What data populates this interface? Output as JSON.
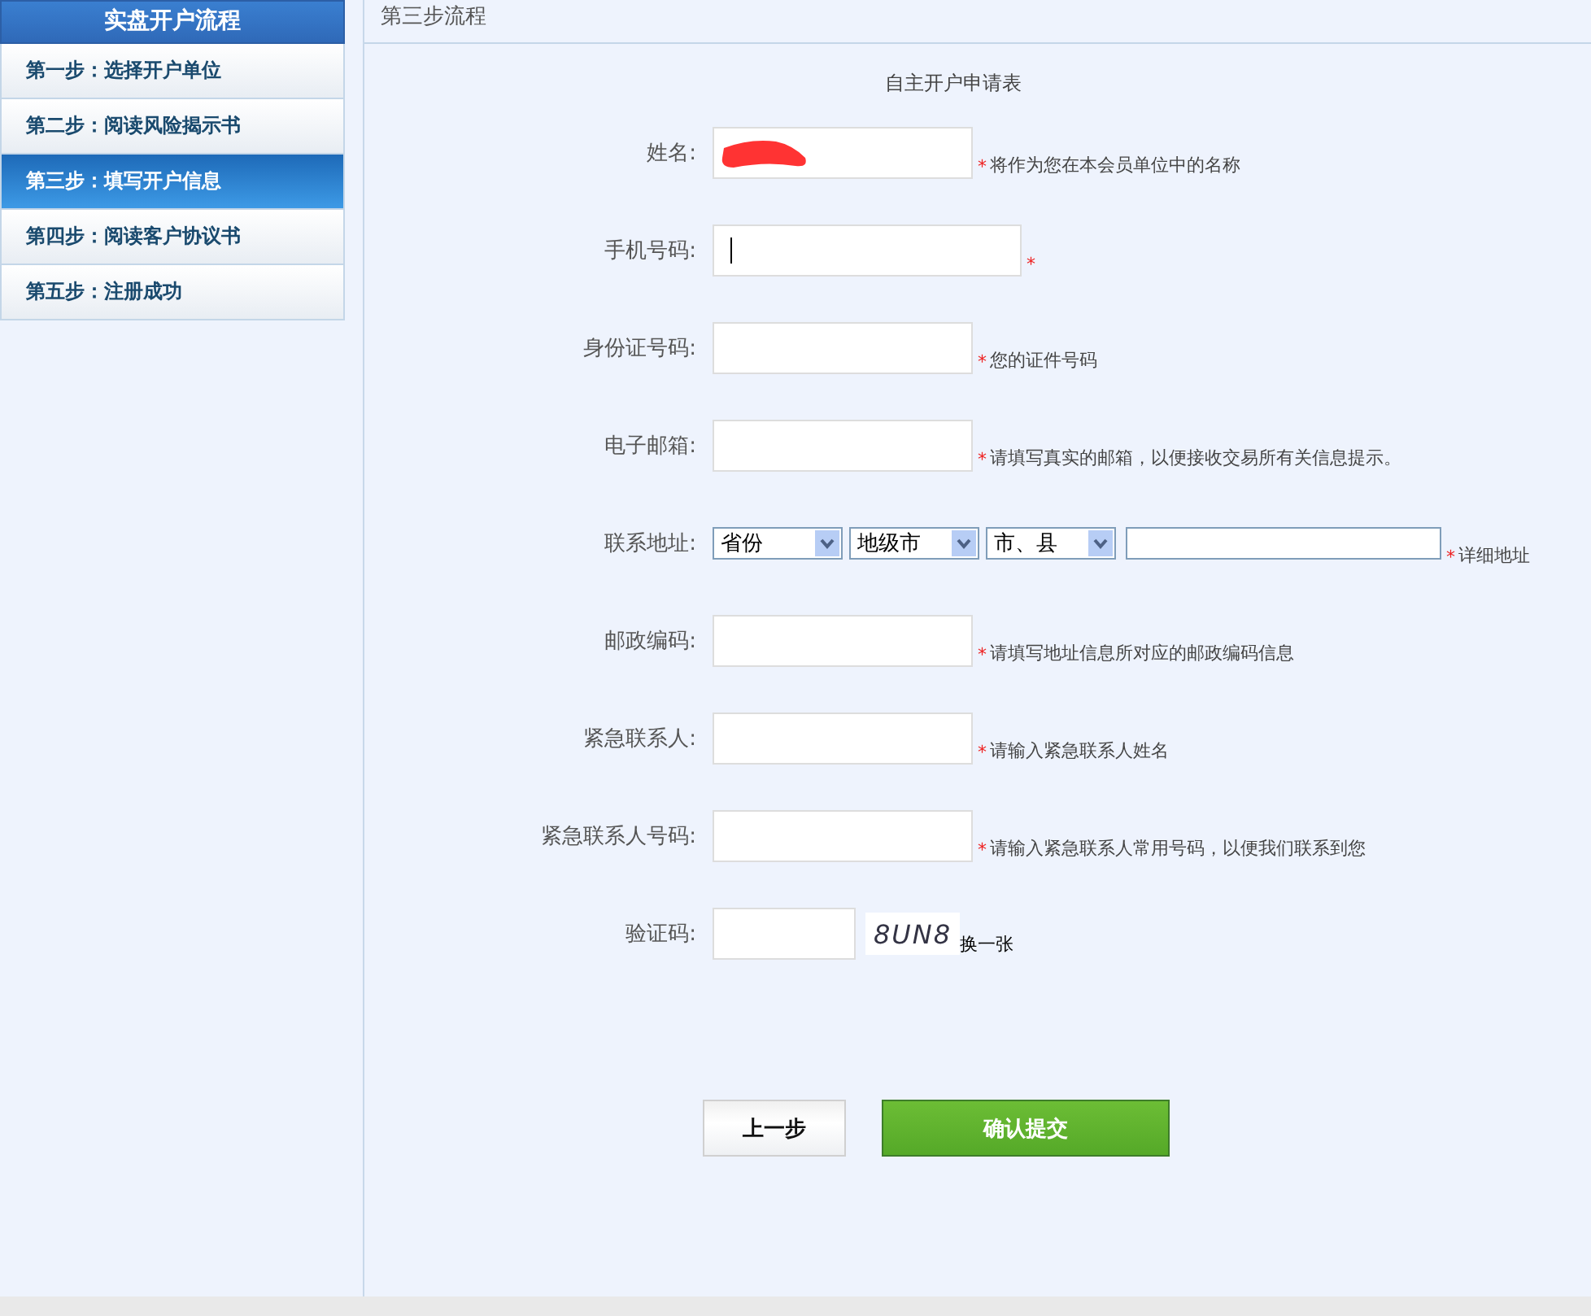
{
  "sidebar": {
    "title": "实盘开户流程",
    "items": [
      {
        "label": "第一步：选择开户单位",
        "selected": false
      },
      {
        "label": "第二步：阅读风险揭示书",
        "selected": false
      },
      {
        "label": "第三步：填写开户信息",
        "selected": true
      },
      {
        "label": "第四步：阅读客户协议书",
        "selected": false
      },
      {
        "label": "第五步：注册成功",
        "selected": false
      }
    ]
  },
  "main": {
    "header": "第三步流程",
    "form_title": "自主开户申请表",
    "fields": [
      {
        "kind": "text",
        "label": "姓名:",
        "redacted": true,
        "mark": "*",
        "hint": "将作为您在本会员单位中的名称"
      },
      {
        "kind": "text",
        "label": "手机号码:",
        "focused": true,
        "wide": true,
        "mark": "*"
      },
      {
        "kind": "text",
        "label": "身份证号码:",
        "mark": "*",
        "hint": "您的证件号码"
      },
      {
        "kind": "text",
        "label": "电子邮箱:",
        "mark": "*",
        "hint": "请填写真实的邮箱，以便接收交易所有关信息提示。"
      },
      {
        "kind": "address",
        "label": "联系地址:",
        "selects": [
          "省份",
          "地级市",
          "市、县"
        ],
        "mark": "*",
        "hint": "详细地址"
      },
      {
        "kind": "text",
        "label": "邮政编码:",
        "mark": "*",
        "hint": "请填写地址信息所对应的邮政编码信息"
      },
      {
        "kind": "text",
        "label": "紧急联系人:",
        "mark": "*",
        "hint": "请输入紧急联系人姓名"
      },
      {
        "kind": "text",
        "label": "紧急联系人号码:",
        "mark": "*",
        "hint": "请输入紧急联系人常用号码，以便我们联系到您"
      },
      {
        "kind": "captcha",
        "label": "验证码:",
        "captcha": "8UN8",
        "refresh": "换一张"
      }
    ],
    "buttons": [
      {
        "label": "上一步",
        "kind": "secondary"
      },
      {
        "label": "确认提交",
        "kind": "primary"
      }
    ]
  }
}
